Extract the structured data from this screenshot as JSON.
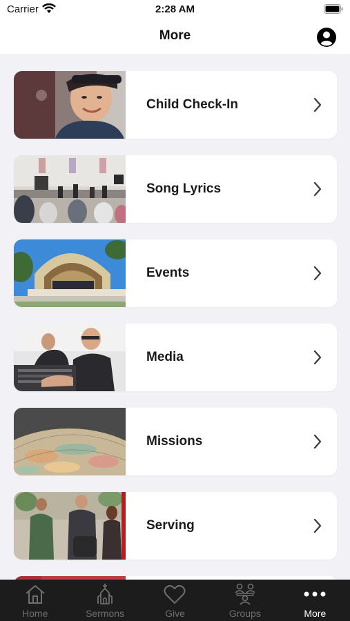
{
  "status_bar": {
    "carrier": "Carrier",
    "time": "2:28 AM"
  },
  "header": {
    "title": "More",
    "profile_icon": "person-circle-icon"
  },
  "menu": {
    "items": [
      {
        "label": "Child Check-In",
        "thumbnail": "child-photo"
      },
      {
        "label": "Song Lyrics",
        "thumbnail": "worship-band-photo"
      },
      {
        "label": "Events",
        "thumbnail": "bandshell-photo"
      },
      {
        "label": "Media",
        "thumbnail": "sound-booth-photo"
      },
      {
        "label": "Missions",
        "thumbnail": "globe-photo"
      },
      {
        "label": "Serving",
        "thumbnail": "volunteers-photo"
      }
    ]
  },
  "tab_bar": {
    "active_color": "#ffffff",
    "inactive_color": "#6f6f6f",
    "tabs": [
      {
        "label": "Home",
        "icon": "home-icon",
        "active": false
      },
      {
        "label": "Sermons",
        "icon": "church-icon",
        "active": false
      },
      {
        "label": "Give",
        "icon": "heart-icon",
        "active": false
      },
      {
        "label": "Groups",
        "icon": "groups-icon",
        "active": false
      },
      {
        "label": "More",
        "icon": "more-dots-icon",
        "active": true
      }
    ]
  }
}
